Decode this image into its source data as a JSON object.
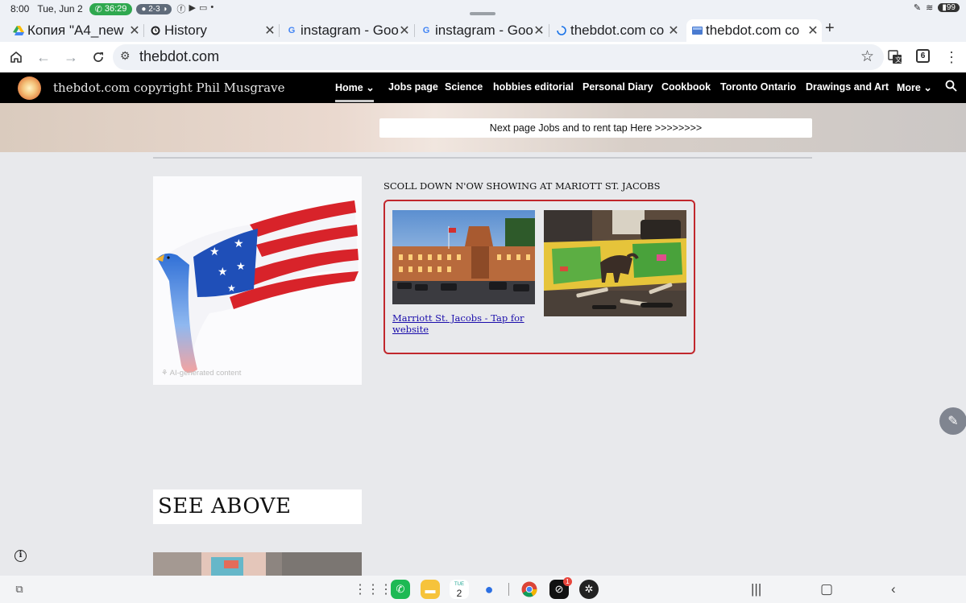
{
  "status_bar": {
    "time": "8:00",
    "date": "Tue, Jun 2",
    "call_timer": "36:29",
    "score": "2-3",
    "battery": "99"
  },
  "tabs": [
    {
      "title": "Копия \"A4_news",
      "favicon": "drive-icon"
    },
    {
      "title": "History",
      "favicon": "history-icon"
    },
    {
      "title": "instagram - Goo",
      "favicon": "google-icon"
    },
    {
      "title": "instagram - Goo",
      "favicon": "google-icon"
    },
    {
      "title": "thebdot.com co",
      "favicon": "loading-icon"
    },
    {
      "title": "thebdot.com co",
      "favicon": "site-icon",
      "active": true
    }
  ],
  "omnibox": {
    "url": "thebdot.com",
    "tab_count": "6"
  },
  "site": {
    "title": "thebdot.com copyright Phil Musgrave",
    "nav": [
      {
        "label": "Home",
        "has_chevron": true,
        "active": true
      },
      {
        "label": "Jobs page"
      },
      {
        "label": "Science"
      },
      {
        "label": "hobbies editorial"
      },
      {
        "label": "Personal Diary"
      },
      {
        "label": "Cookbook"
      },
      {
        "label": "Toronto Ontario"
      },
      {
        "label": "Drawings and Art"
      },
      {
        "label": "More",
        "has_chevron": true
      }
    ],
    "banner_button": "Next page Jobs and to rent tap Here >>>>>>>>"
  },
  "content": {
    "ai_tag": "AI-generated content",
    "section_heading": "SCOLL DOWN N'OW SHOWING AT MARIOTT ST. JACOBS",
    "hotel_link": "Marriott St. Jacobs - Tap for website",
    "see_above": "SEE ABOVE"
  },
  "taskbar": {
    "calendar_day": "2",
    "calendar_month": "TUE",
    "notification_badge": "1"
  },
  "colors": {
    "nav_background": "#000000",
    "box_border": "#c1272d",
    "link": "#1a0dab",
    "call_pill": "#2fa84f"
  }
}
